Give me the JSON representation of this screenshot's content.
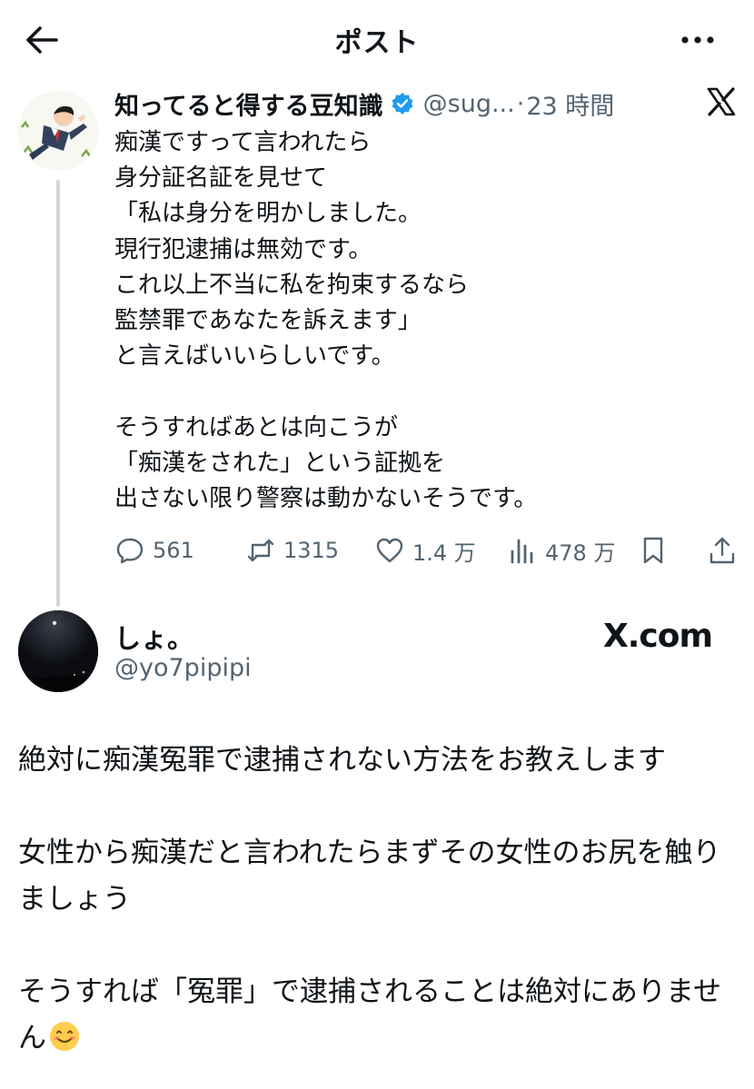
{
  "header": {
    "back_icon": "arrow-left-icon",
    "title": "ポスト",
    "more_icon": "more-horizontal-icon"
  },
  "tweet": {
    "author_name": "知ってると得する豆知識",
    "verified": true,
    "handle": "@sug...",
    "separator": "·",
    "time": "23 時間",
    "text": "痴漢ですって言われたら\n身分証名証を見せて\n「私は身分を明かしました。\n現行犯逮捕は無効です。\nこれ以上不当に私を拘束するなら\n監禁罪であなたを訴えます」\nと言えばいいらしいです。\n\nそうすればあとは向こうが\n「痴漢をされた」という証拠を\n出さない限り警察は動かないそうです。",
    "actions": {
      "replies": "561",
      "reposts": "1315",
      "likes": "1.4 万",
      "views": "478 万"
    }
  },
  "reply": {
    "name": "しょ。",
    "handle": "@yo7pipipi",
    "source": "X.com",
    "text": "絶対に痴漢冤罪で逮捕されない方法をお教えします\n\n女性から痴漢だと言われたらまずその女性のお尻を触りましょう\n\nそうすれば「冤罪」で逮捕されることは絶対にありません",
    "emoji": "smiling-face-icon"
  },
  "colors": {
    "text": "#0f1419",
    "secondary": "#536471",
    "verified": "#1d9bf0",
    "thread_line": "#cfd9de"
  }
}
